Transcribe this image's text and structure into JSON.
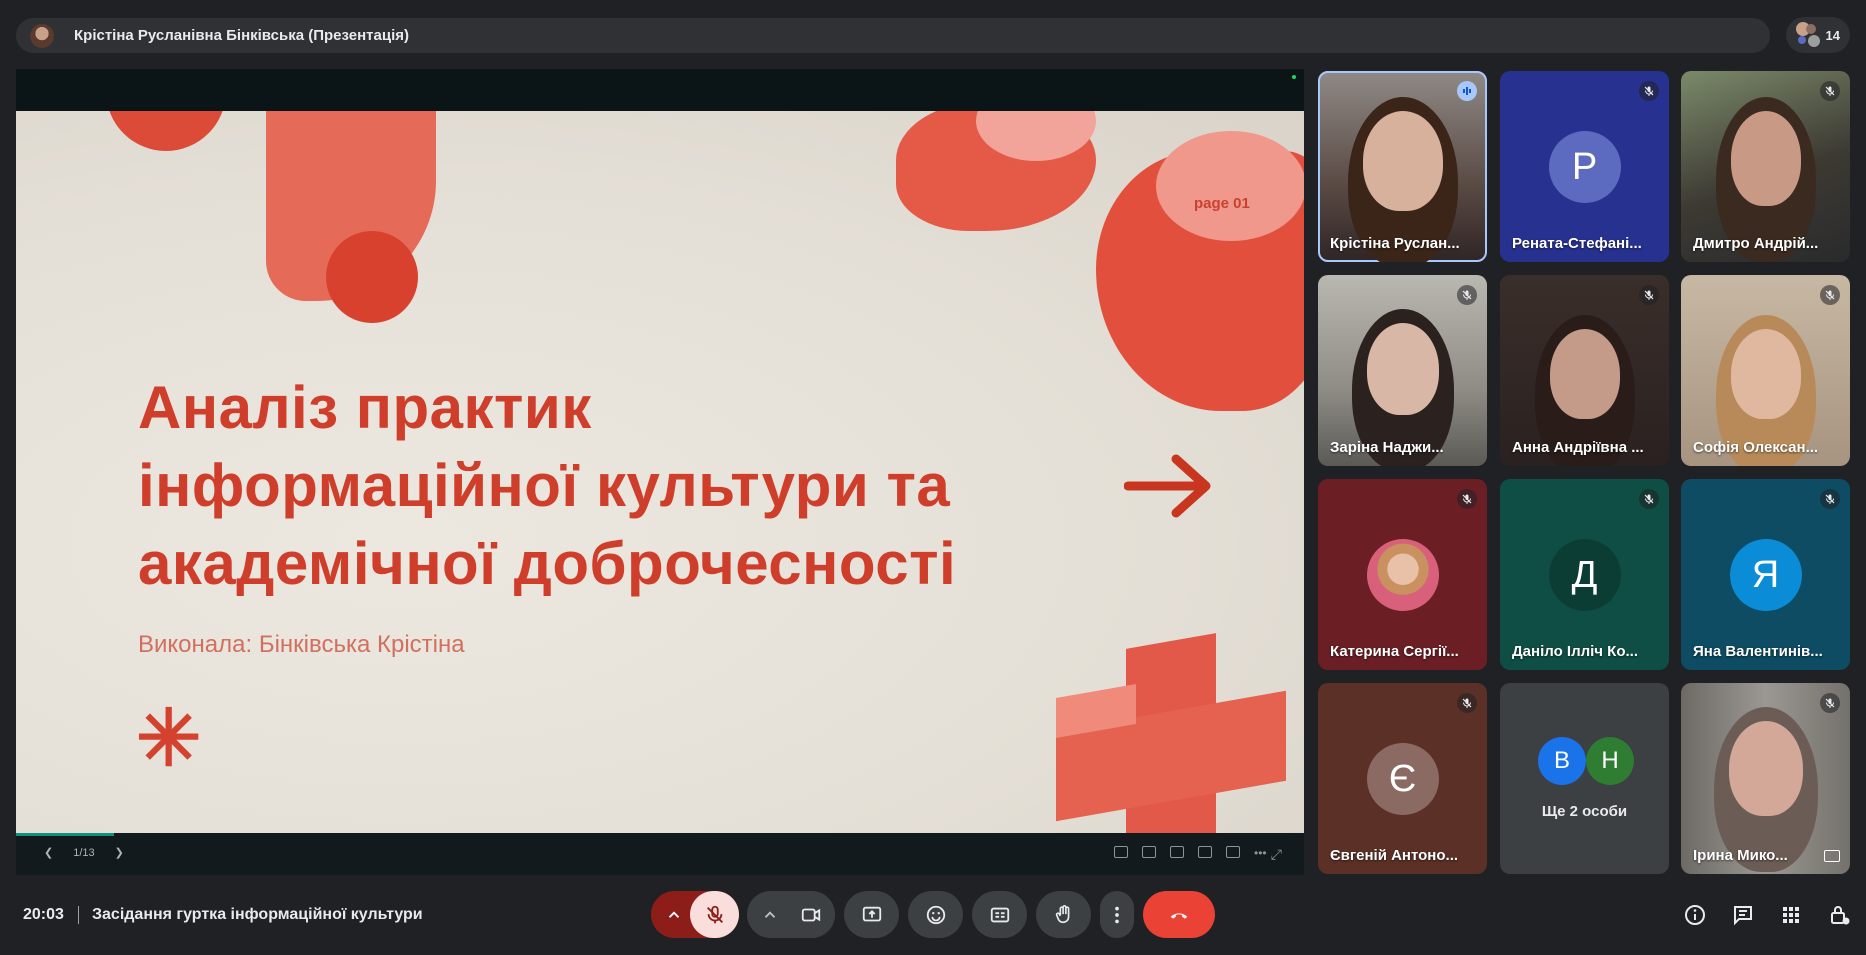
{
  "header": {
    "presenter_title": "Крістіна Русланівна Бінківська (Презентація)",
    "participant_count": "14"
  },
  "slide": {
    "title_line1": "Аналіз практик",
    "title_line2": "інформаційної культури та",
    "title_line3": "академічної доброчесності",
    "author": "Виконала: Бінківська Крістіна",
    "page_label": "page 01",
    "counter": "1/13"
  },
  "participants": [
    {
      "name": "Крістіна Руслан...",
      "type": "video",
      "status": "speaking"
    },
    {
      "name": "Рената-Стефані...",
      "type": "letter",
      "letter": "Р",
      "bg": "#27318f",
      "avatar": "#5c6bc0",
      "status": "muted"
    },
    {
      "name": "Дмитро Андрій...",
      "type": "video",
      "status": "muted"
    },
    {
      "name": "Заріна Наджи...",
      "type": "video",
      "status": "muted"
    },
    {
      "name": "Анна Андріївна ...",
      "type": "video",
      "status": "muted"
    },
    {
      "name": "Софія Олексан...",
      "type": "video",
      "status": "muted"
    },
    {
      "name": "Катерина Сергії...",
      "type": "photo",
      "bg": "#6b1f24",
      "status": "muted"
    },
    {
      "name": "Даніло Ілліч Ко...",
      "type": "letter",
      "letter": "Д",
      "bg": "#0f4e44",
      "avatar": "#0b3d35",
      "status": "muted"
    },
    {
      "name": "Яна Валентинів...",
      "type": "letter",
      "letter": "Я",
      "bg": "#0d4c63",
      "avatar": "#0a8cd6",
      "status": "muted"
    },
    {
      "name": "Євгеній Антоно...",
      "type": "letter",
      "letter": "Є",
      "bg": "#5b3127",
      "avatar": "#8a6a62",
      "status": "muted"
    },
    {
      "name": "Ще 2 особи",
      "type": "more",
      "letters": [
        "В",
        "Н"
      ],
      "colors": [
        "#1a73e8",
        "#2e7d32"
      ]
    },
    {
      "name": "Ірина Мико...",
      "type": "video",
      "status": "muted"
    }
  ],
  "footer": {
    "time": "20:03",
    "meeting": "Засідання гуртка інформаційної культури"
  },
  "colors": {
    "end_call": "#ea4335",
    "mic_muted": "#f9dedc",
    "mic_toggle": "#8c1d18"
  }
}
